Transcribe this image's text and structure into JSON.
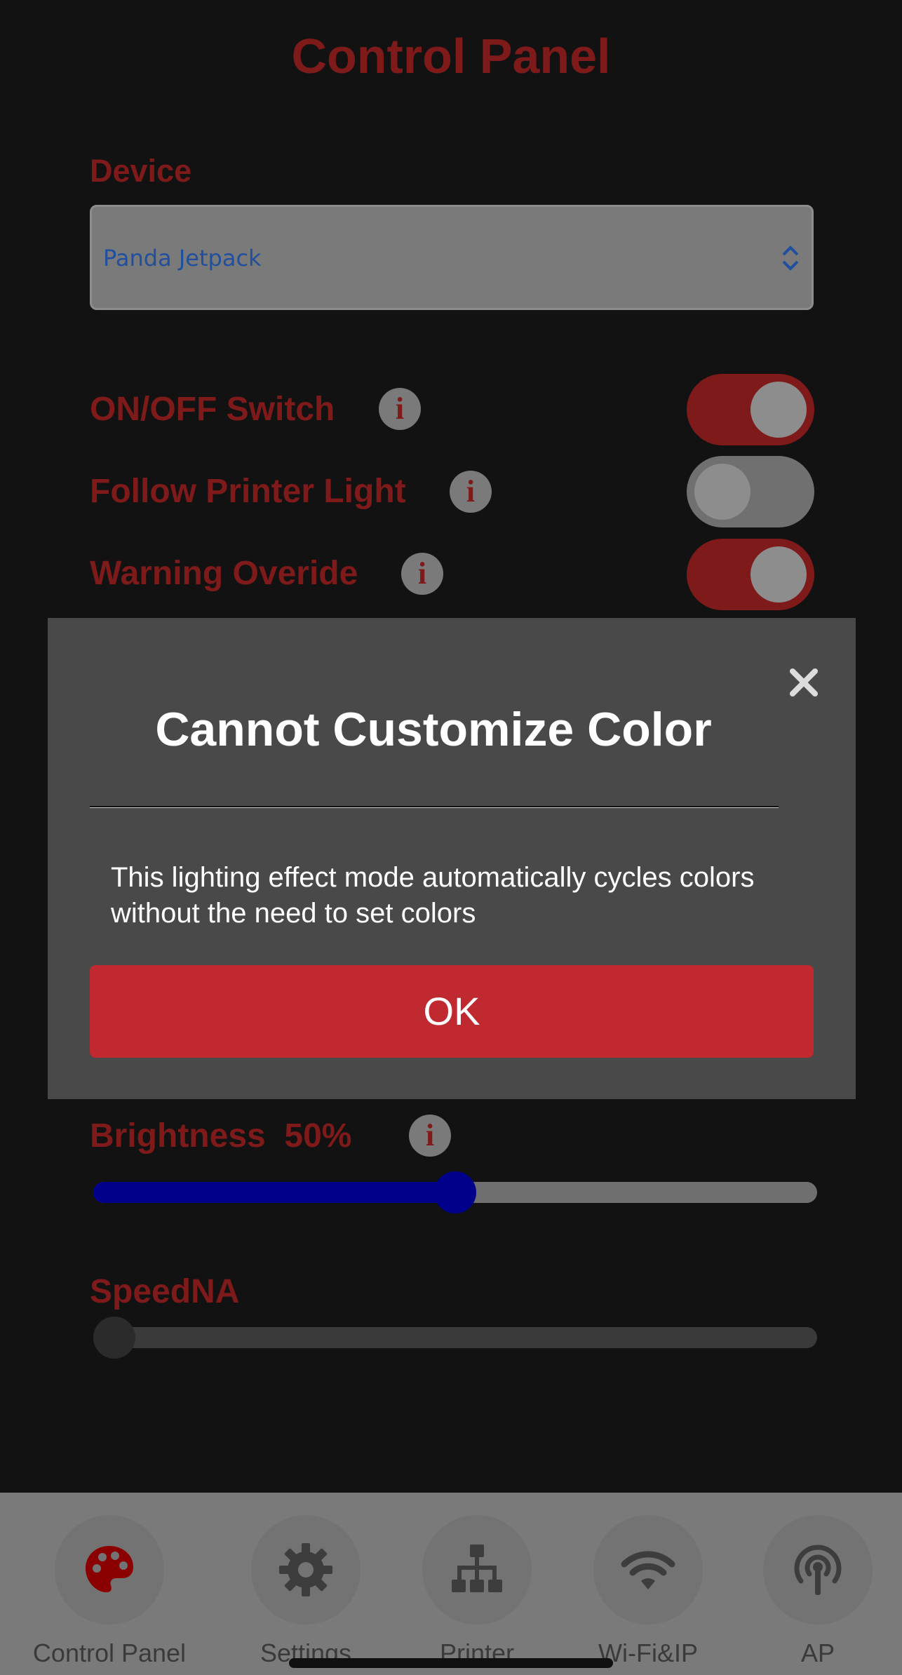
{
  "page": {
    "title": "Control Panel"
  },
  "device": {
    "label": "Device",
    "selected": "Panda Jetpack"
  },
  "toggles": [
    {
      "label": "ON/OFF Switch",
      "state": "on"
    },
    {
      "label": "Follow Printer Light",
      "state": "off"
    },
    {
      "label": "Warning Overide",
      "state": "on"
    }
  ],
  "info_glyph": "i",
  "modal": {
    "title": "Cannot Customize Color",
    "message": "This lighting effect mode automatically cycles colors without the need to set colors",
    "ok_label": "OK",
    "close_icon": "close-icon"
  },
  "brightness": {
    "label": "Brightness",
    "value_text": "50%",
    "value": 0.5,
    "fill_color": "#00008b"
  },
  "speed": {
    "label": "SpeedNA",
    "value": 0
  },
  "tabs": [
    {
      "label": "Control Panel",
      "icon": "palette-icon",
      "active": true
    },
    {
      "label": "Settings",
      "icon": "gear-icon",
      "active": false
    },
    {
      "label": "Printer",
      "icon": "network-icon",
      "active": false
    },
    {
      "label": "Wi-Fi&IP",
      "icon": "wifi-icon",
      "active": false
    },
    {
      "label": "AP",
      "icon": "antenna-icon",
      "active": false
    }
  ],
  "colors": {
    "accent": "#7e1a1a",
    "ok_button": "#c0292f",
    "active_tab_icon": "#8b0000"
  }
}
